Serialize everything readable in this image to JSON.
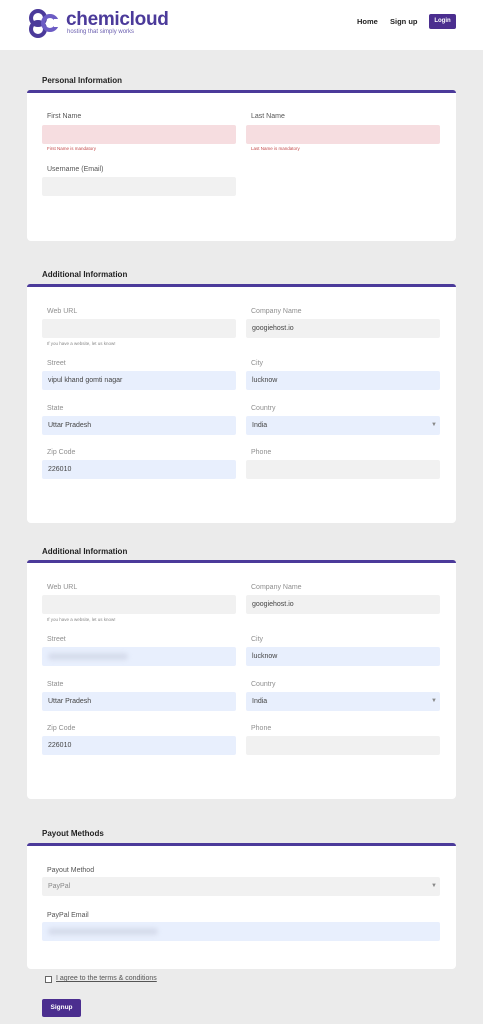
{
  "header": {
    "logo_name": "chemicloud",
    "logo_tagline": "hosting that simply works",
    "nav_home": "Home",
    "nav_signup": "Sign up",
    "login_label": "Login"
  },
  "personal": {
    "title": "Personal Information",
    "first_name_label": "First Name",
    "first_name_error": "First Name is mandatory",
    "last_name_label": "Last Name",
    "last_name_error": "Last Name is mandatory",
    "username_label": "Username (Email)"
  },
  "additional1": {
    "title": "Additional Information",
    "web_url_label": "Web URL",
    "web_url_hint": "If you have a website, let us know!",
    "company_label": "Company Name",
    "company_value": "googiehost.io",
    "street_label": "Street",
    "street_value": "vipul khand gomti nagar",
    "city_label": "City",
    "city_value": "lucknow",
    "state_label": "State",
    "state_value": "Uttar Pradesh",
    "country_label": "Country",
    "country_value": "India",
    "zip_label": "Zip Code",
    "zip_value": "226010",
    "phone_label": "Phone"
  },
  "additional2": {
    "title": "Additional Information",
    "web_url_label": "Web URL",
    "web_url_hint": "If you have a website, let us know!",
    "company_label": "Company Name",
    "company_value": "googiehost.io",
    "street_label": "Street",
    "city_label": "City",
    "city_value": "lucknow",
    "state_label": "State",
    "state_value": "Uttar Pradesh",
    "country_label": "Country",
    "country_value": "India",
    "zip_label": "Zip Code",
    "zip_value": "226010",
    "phone_label": "Phone"
  },
  "payout": {
    "title": "Payout Methods",
    "method_label": "Payout Method",
    "method_value": "PayPal",
    "email_label": "PayPal Email"
  },
  "footer": {
    "agree_label": "I agree to the terms & conditions",
    "signup_label": "Signup"
  },
  "colors": {
    "brand": "#4b3a9a",
    "button": "#4b2e8f",
    "error_field": "#f6dde0",
    "filled_field": "#e8effd"
  }
}
